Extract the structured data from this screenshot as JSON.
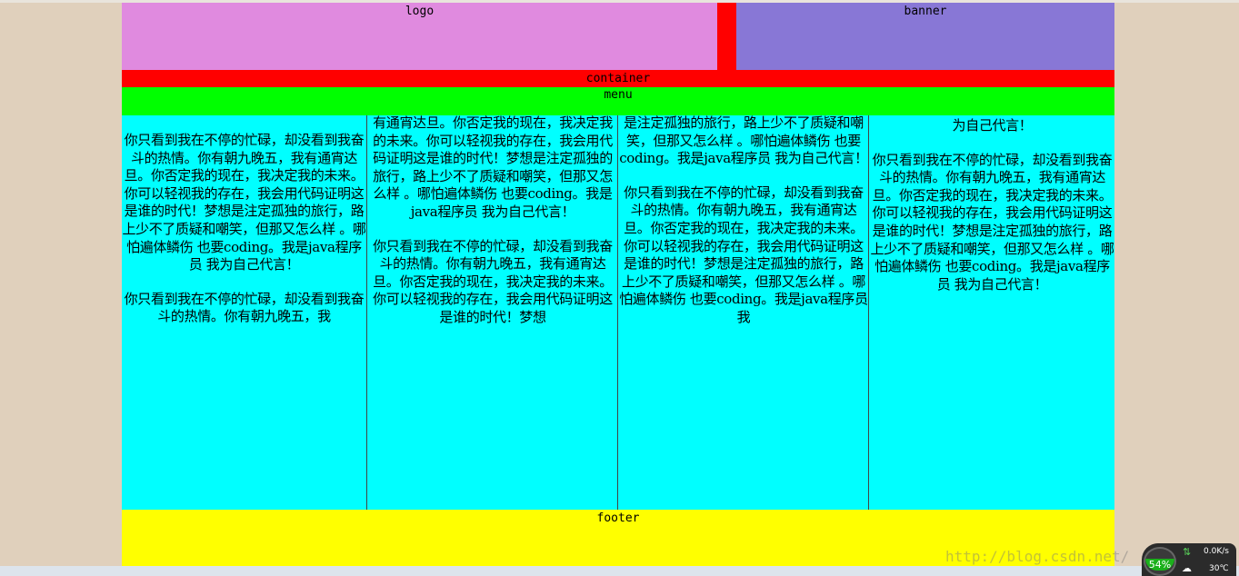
{
  "layout": {
    "logo_label": "logo",
    "banner_label": "banner",
    "container_label": "container",
    "menu_label": "menu",
    "footer_label": "footer"
  },
  "columns": [
    {
      "paragraphs": [
        "你只看到我在不停的忙碌，却没看到我奋斗的热情。你有朝九晚五，我有通宵达旦。你否定我的现在，我决定我的未来。你可以轻视我的存在，我会用代码证明这是谁的时代！梦想是注定孤独的旅行，路上少不了质疑和嘲笑，但那又怎么样 。哪怕遍体鳞伤 也要coding。我是java程序员 我为自己代言！",
        "你只看到我在不停的忙碌，却没看到我奋斗的热情。你有朝九晚五，我"
      ]
    },
    {
      "paragraphs": [
        "有通宵达旦。你否定我的现在，我决定我的未来。你可以轻视我的存在，我会用代码证明这是谁的时代！梦想是注定孤独的旅行，路上少不了质疑和嘲笑，但那又怎么样 。哪怕遍体鳞伤 也要coding。我是java程序员 我为自己代言！",
        "你只看到我在不停的忙碌，却没看到我奋斗的热情。你有朝九晚五，我有通宵达旦。你否定我的现在，我决定我的未来。你可以轻视我的存在，我会用代码证明这是谁的时代！梦想"
      ]
    },
    {
      "paragraphs": [
        "是注定孤独的旅行，路上少不了质疑和嘲笑，但那又怎么样 。哪怕遍体鳞伤 也要coding。我是java程序员 我为自己代言！",
        "你只看到我在不停的忙碌，却没看到我奋斗的热情。你有朝九晚五，我有通宵达旦。你否定我的现在，我决定我的未来。你可以轻视我的存在，我会用代码证明这是谁的时代！梦想是注定孤独的旅行，路上少不了质疑和嘲笑，但那又怎么样 。哪怕遍体鳞伤 也要coding。我是java程序员 我"
      ]
    },
    {
      "paragraphs": [
        "为自己代言！",
        "你只看到我在不停的忙碌，却没看到我奋斗的热情。你有朝九晚五，我有通宵达旦。你否定我的现在，我决定我的未来。你可以轻视我的存在，我会用代码证明这是谁的时代！梦想是注定孤独的旅行，路上少不了质疑和嘲笑，但那又怎么样 。哪怕遍体鳞伤 也要coding。我是java程序员 我为自己代言！"
      ]
    }
  ],
  "watermark": "http://blog.csdn.net/",
  "system_gadget": {
    "cpu_percent": "54%",
    "net_speed": "0.0K/s",
    "temperature": "30℃"
  }
}
